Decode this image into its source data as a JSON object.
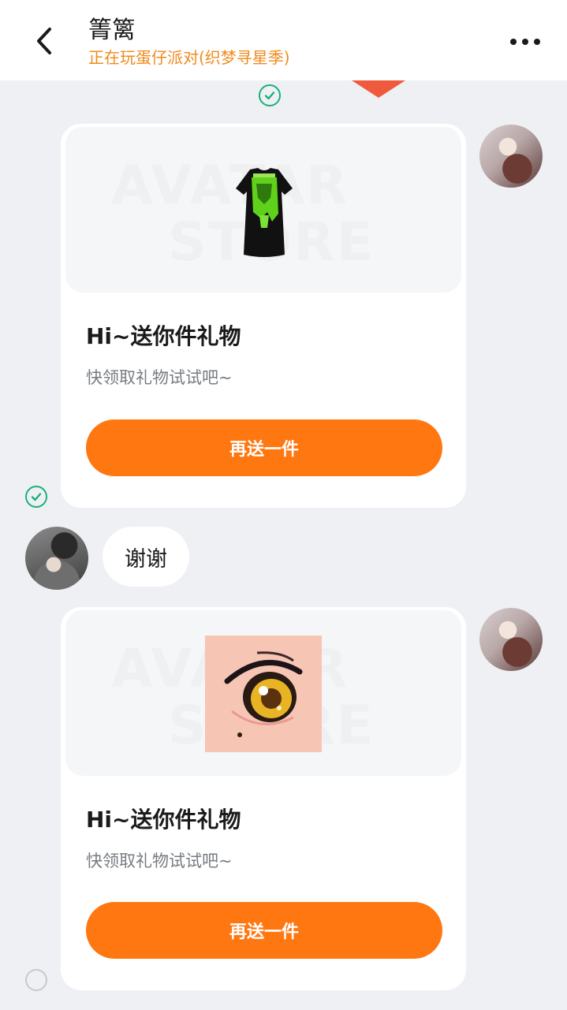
{
  "header": {
    "title": "箐篱",
    "subtitle": "正在玩蛋仔派对(织梦寻星季)"
  },
  "icons": {
    "back": "chevron-left-icon",
    "more": "more-horizontal-icon",
    "sent": "check-circle-icon",
    "pending": "circle-icon"
  },
  "messages": [
    {
      "type": "gift",
      "sender": "self",
      "item_icon": "tshirt-icon",
      "title": "Hi~送你件礼物",
      "description": "快领取礼物试试吧~",
      "button_label": "再送一件"
    },
    {
      "type": "text",
      "sender": "friend",
      "text": "谢谢"
    },
    {
      "type": "gift",
      "sender": "self",
      "item_icon": "anime-eye-icon",
      "title": "Hi~送你件礼物",
      "description": "快领取礼物试试吧~",
      "button_label": "再送一件"
    }
  ],
  "watermark": [
    "AVATAR",
    "STORE"
  ],
  "colors": {
    "accent": "#ff7711",
    "subtitle": "#f08a1c",
    "sent_check": "#1bb07a",
    "background": "#eef0f4"
  }
}
